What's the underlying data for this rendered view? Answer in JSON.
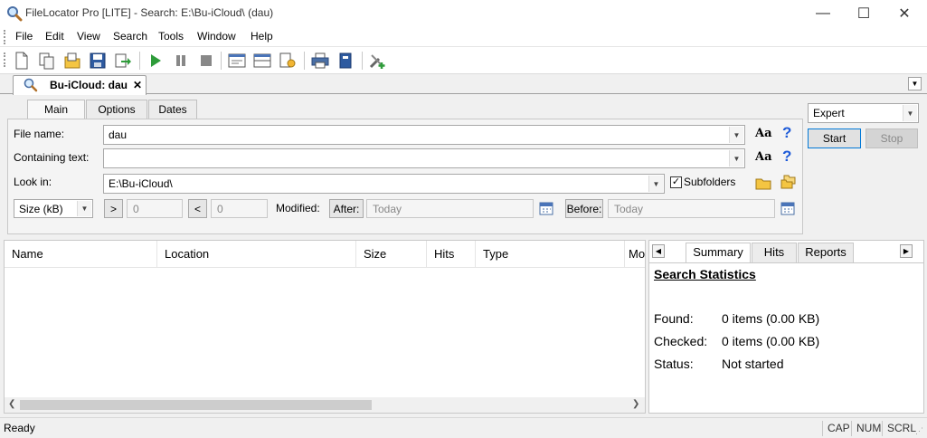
{
  "window": {
    "title": "FileLocator Pro [LITE] - Search: E:\\Bu-iCloud\\ (dau)",
    "minimize": "—",
    "maximize": "☐",
    "close": "✕"
  },
  "menu": [
    "File",
    "Edit",
    "View",
    "Search",
    "Tools",
    "Window",
    "Help"
  ],
  "document_tab": {
    "label": "Bu-iCloud: dau",
    "close": "✕"
  },
  "panel_tabs": [
    "Main",
    "Options",
    "Dates"
  ],
  "form": {
    "file_name_label": "File name:",
    "file_name_value": "dau",
    "containing_label": "Containing text:",
    "containing_value": "",
    "look_in_label": "Look in:",
    "look_in_value": "E:\\Bu-iCloud\\",
    "subfolders_label": "Subfolders",
    "subfolders_checked": true,
    "size_unit": "Size (kB)",
    "greater_label": ">",
    "greater_value": "0",
    "less_label": "<",
    "less_value": "0",
    "modified_label": "Modified:",
    "after_label": "After:",
    "after_value": "Today",
    "before_label": "Before:",
    "before_value": "Today",
    "aa": "Aa",
    "help": "?"
  },
  "control": {
    "mode": "Expert",
    "start": "Start",
    "stop": "Stop"
  },
  "results": {
    "columns": [
      "Name",
      "Location",
      "Size",
      "Hits",
      "Type",
      "Mo"
    ]
  },
  "summary": {
    "tabs": [
      "Summary",
      "Hits",
      "Reports"
    ],
    "heading": "Search Statistics",
    "found_label": "Found:",
    "found_value": "0 items (0.00 KB)",
    "checked_label": "Checked:",
    "checked_value": "0 items (0.00 KB)",
    "status_label": "Status:",
    "status_value": "Not started"
  },
  "statusbar": {
    "text": "Ready",
    "indicators": [
      "CAP",
      "NUM",
      "SCRL"
    ]
  },
  "colors": {
    "accent_blue": "#1e5bd8",
    "play_green": "#2e9c3a"
  }
}
